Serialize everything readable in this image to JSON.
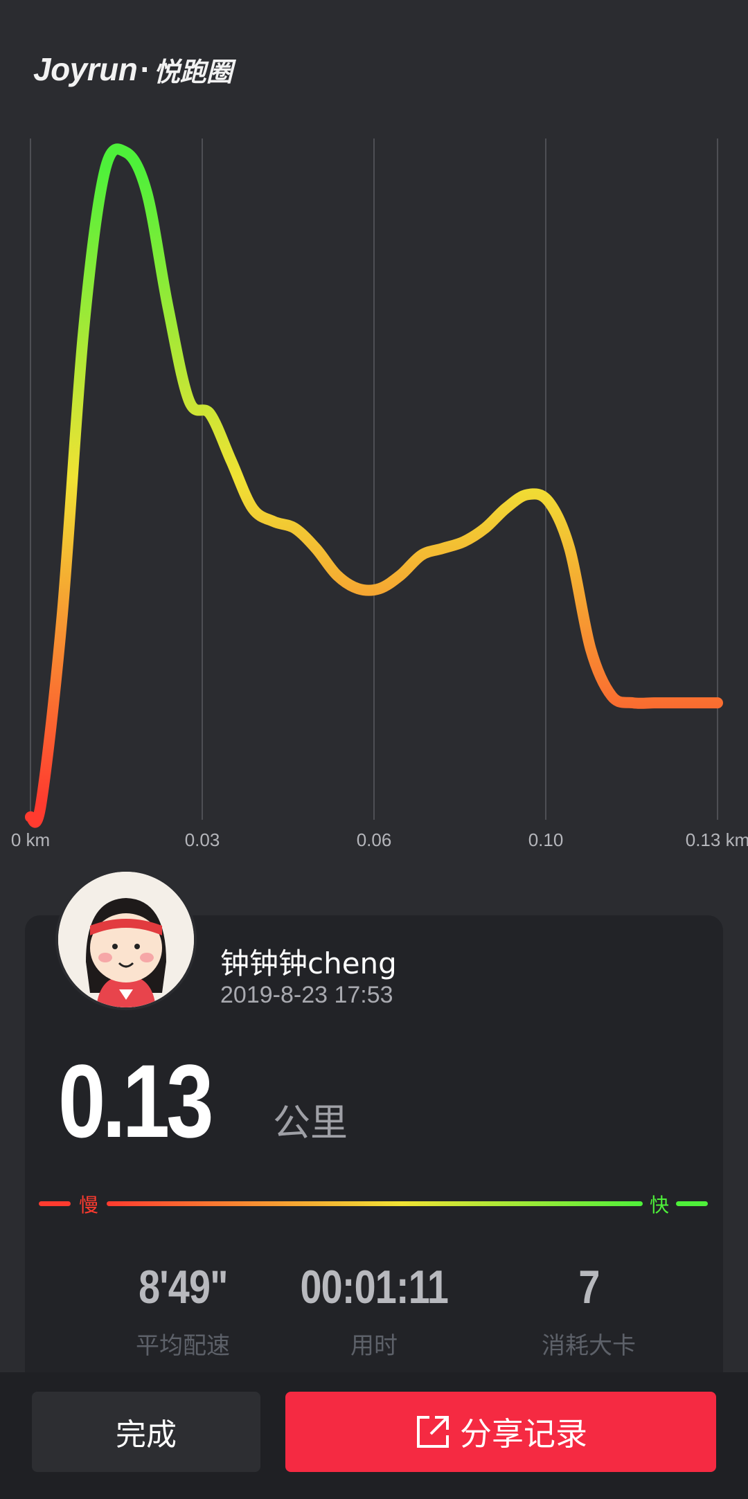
{
  "header": {
    "logo_en": "Joyrun",
    "logo_dot": "·",
    "logo_cn": "悦跑圈"
  },
  "chart_data": {
    "type": "line",
    "title": "",
    "xlabel": "",
    "ylabel": "",
    "x_tick_labels": [
      "0 km",
      "0.03",
      "0.06",
      "0.10",
      "0.13 km"
    ],
    "x_range": [
      0,
      0.13
    ],
    "grid": "vertical lines at tick labels",
    "series": [
      {
        "x": [
          0,
          0.002,
          0.006,
          0.01,
          0.014,
          0.018,
          0.022,
          0.026,
          0.03,
          0.034,
          0.038,
          0.042,
          0.046,
          0.05,
          0.054,
          0.058,
          0.062,
          0.066,
          0.07,
          0.074,
          0.078,
          0.082,
          0.086,
          0.09,
          0.094,
          0.098,
          0.102,
          0.106,
          0.11,
          0.114,
          0.118,
          0.122,
          0.126,
          0.13
        ],
        "y": [
          0.0,
          0.02,
          0.3,
          0.72,
          0.96,
          0.99,
          0.93,
          0.76,
          0.62,
          0.6,
          0.53,
          0.46,
          0.44,
          0.43,
          0.4,
          0.36,
          0.34,
          0.34,
          0.36,
          0.39,
          0.4,
          0.41,
          0.43,
          0.46,
          0.48,
          0.47,
          0.4,
          0.25,
          0.18,
          0.17,
          0.17,
          0.17,
          0.17,
          0.17
        ],
        "y_meaning": "relative pace, 0 = slow (red), 1 = fast (green)"
      }
    ],
    "colors": {
      "slow": "#ff3b2f",
      "mid": "#f0e234",
      "fast": "#4ef03a"
    }
  },
  "user": {
    "name": "钟钟钟cheng",
    "time": "2019-8-23 17:53"
  },
  "summary": {
    "distance": "0.13",
    "distance_unit": "公里"
  },
  "speed_legend": {
    "slow": "慢",
    "fast": "快"
  },
  "stats": [
    {
      "value": "8'49\"",
      "label": "平均配速"
    },
    {
      "value": "00:01:11",
      "label": "用时"
    },
    {
      "value": "7",
      "label": "消耗大卡"
    }
  ],
  "buttons": {
    "done": "完成",
    "share": "分享记录",
    "share_icon": "share-icon"
  }
}
